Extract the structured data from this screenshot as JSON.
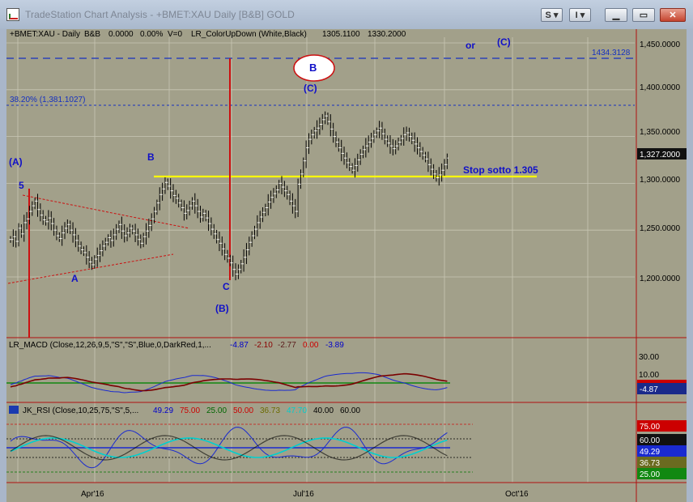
{
  "window": {
    "title": "TradeStation Chart Analysis - +BMET:XAU Daily [B&B] GOLD",
    "buttons": {
      "s": "S",
      "i": "I"
    }
  },
  "header": {
    "symbol": "+BMET:XAU - Daily",
    "bb": "B&B",
    "change": "0.0000",
    "pct": "0.00%",
    "vol": "V=0",
    "indicator": "LR_ColorUpDown (White,Black)",
    "low": "1305.1100",
    "high": "1330.2000"
  },
  "annotations": {
    "or": "or",
    "c_paren_right": "(C)",
    "level_label": "1434.3128",
    "b_circle": "B",
    "c_paren": "(C)",
    "fib": "38.20% (1,381.1027)",
    "a_paren": "(A)",
    "b_left": "B",
    "five": "5",
    "stop": "Stop sotto 1.305",
    "a_low": "A",
    "c_low": "C",
    "b_paren": "(B)"
  },
  "price_axis": {
    "ticks": [
      "1,450.0000",
      "1,400.0000",
      "1,350.0000",
      "1,300.0000",
      "1,250.0000",
      "1,200.0000"
    ],
    "last_price": "1,327.2000"
  },
  "macd": {
    "label": "LR_MACD (Close,12,26,9,5,\"S\",\"S\",Blue,0,DarkRed,1,...",
    "values": [
      "-4.87",
      "-2.10",
      "-2.77",
      "0.00",
      "-3.89"
    ],
    "value_colors": [
      "#0000cc",
      "#8b0000",
      "#5a1a1a",
      "#cc0000",
      "#0000cc"
    ],
    "ticks": [
      "30.00",
      "10.00"
    ],
    "current": "-4.87"
  },
  "rsi": {
    "label": "JK_RSI (Close,10,25,75,\"S\",5,...",
    "values": [
      "49.29",
      "75.00",
      "25.00",
      "50.00",
      "36.73",
      "47.70",
      "40.00",
      "60.00"
    ],
    "value_colors": [
      "#0000cc",
      "#cc0000",
      "#006600",
      "#cc0000",
      "#6b6b00",
      "#00cccc",
      "#000000",
      "#000000"
    ],
    "badges": [
      "75.00",
      "60.00",
      "49.29",
      "36.73",
      "25.00"
    ]
  },
  "time_axis": {
    "labels": [
      "Apr'16",
      "Jul'16",
      "Oct'16"
    ]
  },
  "chart_data": {
    "type": "ohlc",
    "y_range": [
      1150,
      1460
    ],
    "closes": [
      1240,
      1243,
      1238,
      1252,
      1246,
      1258,
      1262,
      1270,
      1276,
      1281,
      1272,
      1266,
      1261,
      1259,
      1263,
      1257,
      1250,
      1244,
      1241,
      1247,
      1252,
      1256,
      1250,
      1245,
      1239,
      1233,
      1229,
      1226,
      1221,
      1216,
      1213,
      1219,
      1223,
      1228,
      1233,
      1237,
      1242,
      1239,
      1245,
      1251,
      1256,
      1249,
      1244,
      1247,
      1252,
      1249,
      1245,
      1240,
      1236,
      1243,
      1249,
      1255,
      1262,
      1270,
      1279,
      1288,
      1294,
      1301,
      1297,
      1292,
      1287,
      1284,
      1279,
      1274,
      1268,
      1271,
      1276,
      1281,
      1276,
      1270,
      1264,
      1268,
      1263,
      1257,
      1251,
      1246,
      1240,
      1236,
      1230,
      1224,
      1220,
      1215,
      1208,
      1203,
      1208,
      1214,
      1221,
      1229,
      1237,
      1244,
      1251,
      1258,
      1264,
      1269,
      1274,
      1280,
      1285,
      1289,
      1293,
      1300,
      1296,
      1292,
      1288,
      1281,
      1276,
      1270,
      1299,
      1310,
      1324,
      1338,
      1347,
      1352,
      1356,
      1359,
      1363,
      1368,
      1372,
      1366,
      1358,
      1350,
      1344,
      1338,
      1332,
      1327,
      1322,
      1318,
      1314,
      1319,
      1325,
      1331,
      1336,
      1340,
      1344,
      1348,
      1352,
      1356,
      1359,
      1353,
      1347,
      1343,
      1340,
      1337,
      1340,
      1344,
      1348,
      1352,
      1354,
      1350,
      1346,
      1342,
      1338,
      1334,
      1330,
      1326,
      1320,
      1315,
      1310,
      1306,
      1309,
      1314,
      1320,
      1327
    ],
    "highs_offsets_note": "",
    "levels": {
      "fib_38_2": 1381.1027,
      "upper_dash": 1434.3128,
      "stop": 1305
    },
    "macd_axis": [
      30,
      10
    ],
    "rsi_levels": [
      75,
      60,
      50,
      40,
      25
    ]
  }
}
